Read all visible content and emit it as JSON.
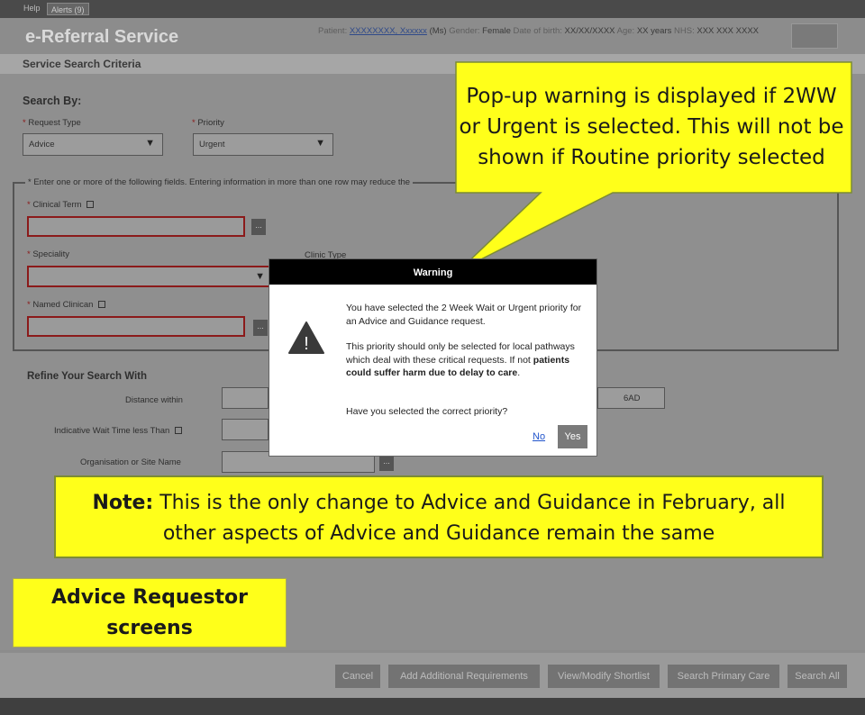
{
  "topbar": {
    "help_label": "Help",
    "alerts_label": "Alerts (9)"
  },
  "header": {
    "app_title": "e-Referral Service",
    "patient_label": "Patient:",
    "patient_name": "XXXXXXXX, Xxxxxx",
    "patient_title": "(Ms)",
    "gender_label": "Gender:",
    "gender_value": "Female",
    "dob_label": "Date of birth:",
    "dob_value": "XX/XX/XXXX",
    "age_label": "Age:",
    "age_value": "XX years",
    "nhs_label": "NHS:",
    "nhs_value": "XXX XXX XXXX"
  },
  "section_title": "Service Search Criteria",
  "search_by": {
    "heading": "Search By:",
    "request_type_label": "Request Type",
    "request_type_value": "Advice",
    "priority_label": "Priority",
    "priority_value": "Urgent",
    "required_marker": "*",
    "fields_note": "* Enter one or more of the following fields. Entering information in more than one row may reduce the"
  },
  "fields": {
    "clinical_term_label": "Clinical Term",
    "speciality_label": "Speciality",
    "clinic_type_label": "Clinic Type",
    "named_clinician_label": "Named Clinican",
    "dots": "..."
  },
  "refine": {
    "heading": "Refine Your Search With",
    "distance_label": "Distance within",
    "postcode_partial": "6AD",
    "wait_label": "Indicative Wait Time less Than",
    "org_label": "Organisation or Site Name"
  },
  "dialog": {
    "title": "Warning",
    "para1": "You have selected the 2 Week Wait or Urgent priority for an Advice and Guidance request.",
    "para2_plain": "This priority should only be selected for local pathways which deal with these critical requests. If not",
    "para2_bold": "patients could suffer harm due to delay to care",
    "para2_end": ".",
    "question": "Have you selected the correct priority?",
    "no_label": "No",
    "yes_label": "Yes",
    "icon": "warning-triangle-icon"
  },
  "footer": {
    "cancel": "Cancel",
    "add_requirements": "Add Additional Requirements",
    "view_shortlist": "View/Modify Shortlist",
    "search_primary": "Search Primary Care",
    "search_all": "Search All"
  },
  "callouts": {
    "popup_line1": "Pop-up warning is displayed if 2WW",
    "popup_line2": "or Urgent is selected. This will not be",
    "popup_line3": "shown if Routine priority selected",
    "note_bold": "Note:",
    "note_line1_rest": " This is the only change to Advice and Guidance in February, all",
    "note_line2": "other aspects of Advice and Guidance remain the same",
    "requestor_line1": "Advice Requestor",
    "requestor_line2": "screens"
  },
  "colors": {
    "callout_yellow": "#ffff1a",
    "required_red": "#8b1a1a",
    "dialog_header": "#000000",
    "link_blue": "#2255cc"
  }
}
